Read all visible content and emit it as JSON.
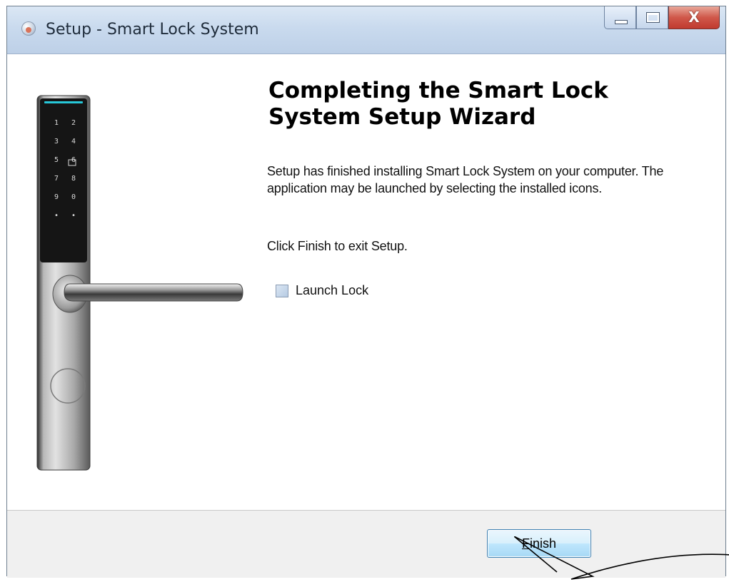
{
  "window": {
    "title": "Setup - Smart Lock System",
    "close_glyph": "X"
  },
  "wizard": {
    "heading": "Completing the Smart Lock System Setup Wizard",
    "body": "Setup has finished installing Smart Lock System on your computer. The application may be launched by selecting the installed icons.",
    "instruction": "Click Finish to exit Setup.",
    "launch_checkbox_label": "Launch Lock",
    "launch_checked": false
  },
  "keypad": [
    "1",
    "2",
    "3",
    "4",
    "5",
    "6",
    "7",
    "8",
    "9",
    "0",
    "•",
    "•"
  ],
  "footer": {
    "finish_mnemonic": "F",
    "finish_rest": "inish"
  },
  "colors": {
    "accent_button": "#bee6fd",
    "keypad_glow": "#27c7d8"
  }
}
